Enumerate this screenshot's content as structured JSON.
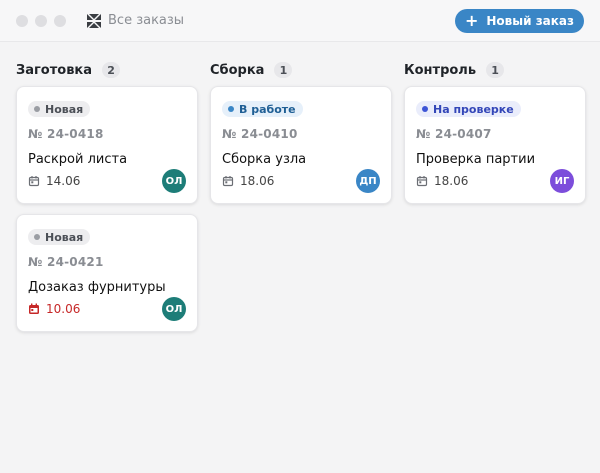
{
  "header": {
    "title": "Все заказы",
    "new_order_label": "Новый заказ",
    "accent": "#3a86c6"
  },
  "columns": [
    {
      "title": "Заготовка",
      "count": "2",
      "cards": [
        {
          "status": "Новая",
          "status_kind": "new",
          "number": "№ 24-0418",
          "title": "Раскрой листа",
          "date": "14.06",
          "overdue": false,
          "assignee": "ОЛ",
          "avatar_color": "#1d7d78"
        },
        {
          "status": "Новая",
          "status_kind": "new",
          "number": "№ 24-0421",
          "title": "Дозаказ фурнитуры",
          "date": "10.06",
          "overdue": true,
          "assignee": "ОЛ",
          "avatar_color": "#1d7d78"
        }
      ]
    },
    {
      "title": "Сборка",
      "count": "1",
      "cards": [
        {
          "status": "В работе",
          "status_kind": "progress",
          "number": "№ 24-0410",
          "title": "Сборка узла",
          "date": "18.06",
          "overdue": false,
          "assignee": "ДП",
          "avatar_color": "#3a86c6"
        }
      ]
    },
    {
      "title": "Контроль",
      "count": "1",
      "cards": [
        {
          "status": "На проверке",
          "status_kind": "review",
          "number": "№ 24-0407",
          "title": "Проверка партии",
          "date": "18.06",
          "overdue": false,
          "assignee": "ИГ",
          "avatar_color": "#7c4ddb"
        }
      ]
    }
  ],
  "status_styles": {
    "new": {
      "bg": "#ededef",
      "fg": "#4b4f56",
      "dot": "#9a9da3"
    },
    "progress": {
      "bg": "#e6f0fa",
      "fg": "#1f5f95",
      "dot": "#3a86c6"
    },
    "review": {
      "bg": "#eaedfb",
      "fg": "#3346b8",
      "dot": "#3d55d6"
    }
  },
  "colors": {
    "overdue": "#c62828"
  }
}
